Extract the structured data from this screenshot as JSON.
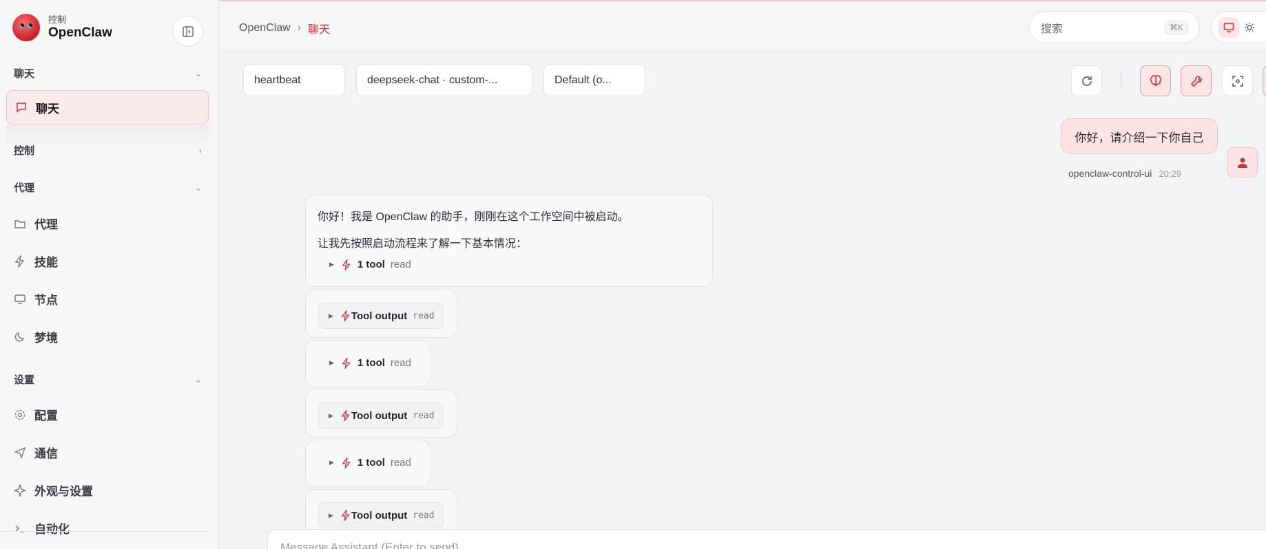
{
  "sidebar": {
    "brand_sub": "控制",
    "brand_name": "OpenClaw",
    "sections": {
      "chat": "聊天",
      "control": "控制",
      "agent": "代理",
      "settings": "设置"
    },
    "items": {
      "chat": "聊天",
      "agents": "代理",
      "skills": "技能",
      "nodes": "节点",
      "dreams": "梦境",
      "config": "配置",
      "comms": "通信",
      "appearance": "外观与设置",
      "automation": "自动化"
    }
  },
  "header": {
    "crumb_root": "OpenClaw",
    "crumb_sep": "›",
    "crumb_current": "聊天",
    "search_label": "搜索",
    "search_shortcut": "⌘K"
  },
  "toolbar": {
    "session": "heartbeat",
    "model": "deepseek-chat · custom-...",
    "mode": "Default (o..."
  },
  "chat": {
    "user_message": "你好，请介绍一下你自己",
    "user_name": "openclaw-control-ui",
    "user_time": "20:29",
    "assistant_line1": "你好！我是 OpenClaw 的助手，刚刚在这个工作空间中被启动。",
    "assistant_line2": "让我先按照启动流程来了解一下基本情况：",
    "tool_call_label": "1 tool",
    "tool_output_label": "Tool output",
    "tool_tag": "read"
  },
  "composer": {
    "placeholder": "Message Assistant (Enter to send)"
  },
  "colors": {
    "accent": "#d0303b",
    "accent_bg": "#fbe5e7"
  }
}
